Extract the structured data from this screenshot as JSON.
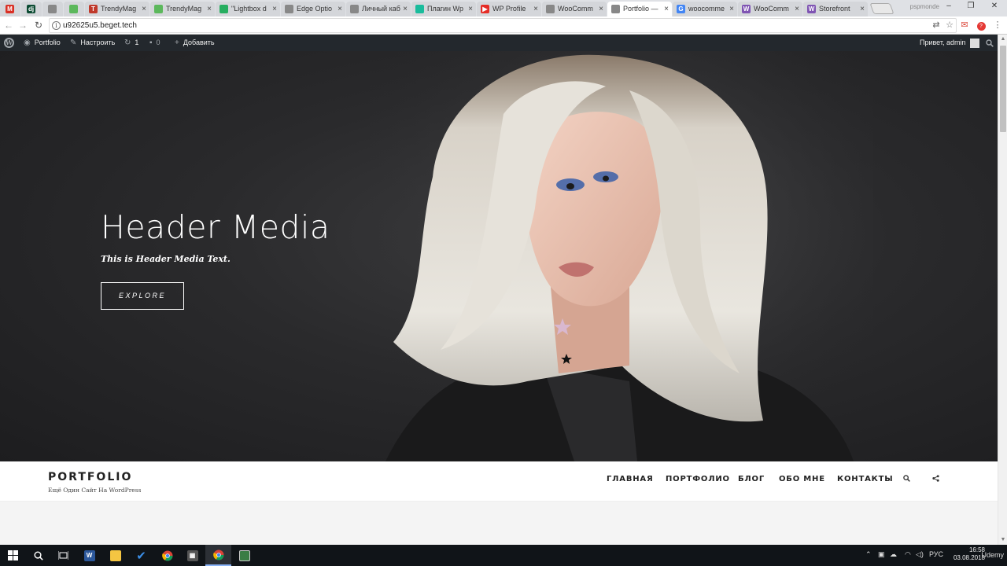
{
  "browser": {
    "tabs": [
      {
        "label": "",
        "icon": "gmail-icon",
        "color": "#d93025",
        "glyph": "M",
        "small": true
      },
      {
        "label": "",
        "icon": "dj-icon",
        "color": "#0c4b33",
        "glyph": "dj",
        "small": true
      },
      {
        "label": "",
        "icon": "page-icon",
        "color": "#888888",
        "glyph": "",
        "small": true
      },
      {
        "label": "",
        "icon": "leaf-icon",
        "color": "#5cb85c",
        "glyph": "",
        "small": true
      },
      {
        "label": "TrendyMag",
        "icon": "trendymag-icon",
        "color": "#c0392b",
        "glyph": "T"
      },
      {
        "label": "TrendyMag",
        "icon": "leaf-icon",
        "color": "#5cb85c",
        "glyph": ""
      },
      {
        "label": "\"Lightbox d",
        "icon": "lightbox-icon",
        "color": "#27ae60",
        "glyph": ""
      },
      {
        "label": "Edge Optio",
        "icon": "page-icon",
        "color": "#888888",
        "glyph": ""
      },
      {
        "label": "Личный каб",
        "icon": "page-icon",
        "color": "#888888",
        "glyph": ""
      },
      {
        "label": "Плагин Wp",
        "icon": "plugin-icon",
        "color": "#1abc9c",
        "glyph": ""
      },
      {
        "label": "WP Profile",
        "icon": "youtube-icon",
        "color": "#e52d27",
        "glyph": "▶"
      },
      {
        "label": "WooComm",
        "icon": "page-icon",
        "color": "#888888",
        "glyph": ""
      },
      {
        "label": "Portfolio —",
        "icon": "page-icon",
        "color": "#888888",
        "glyph": "",
        "active": true
      },
      {
        "label": "woocomme",
        "icon": "google-icon",
        "color": "#4285f4",
        "glyph": "G"
      },
      {
        "label": "WooComm",
        "icon": "woo-icon",
        "color": "#7f54b3",
        "glyph": "W"
      },
      {
        "label": "Storefront",
        "icon": "woo-icon",
        "color": "#7f54b3",
        "glyph": "W"
      }
    ],
    "window_user": "pspmonde",
    "url": "u92625u5.beget.tech"
  },
  "adminbar": {
    "site_label": "Portfolio",
    "customize_label": "Настроить",
    "updates_count": "1",
    "comments_count": "0",
    "add_label": "Добавить",
    "greeting": "Привет, admin"
  },
  "hero": {
    "title": "Header Media",
    "text": "This is Header Media Text.",
    "button": "EXPLORE"
  },
  "site": {
    "title": "PORTFOLIO",
    "description": "Ещё Один Сайт На WordPress",
    "menu": [
      "ГЛАВНАЯ",
      "ПОРТФОЛИО",
      "БЛОГ",
      "ОБО МНЕ",
      "КОНТАКТЫ"
    ]
  },
  "taskbar": {
    "lang": "РУС",
    "time": "16:58",
    "date": "03.08.2018",
    "watermark": "Udemy"
  }
}
